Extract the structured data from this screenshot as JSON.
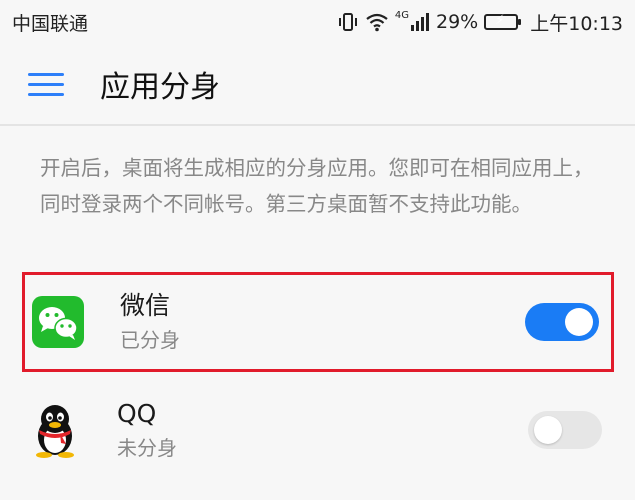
{
  "status_bar": {
    "carrier": "中国联通",
    "network": "4G",
    "battery": "29%",
    "time": "上午10:13",
    "icons": [
      "vibrate-icon",
      "wifi-icon",
      "signal-icon",
      "battery-icon"
    ]
  },
  "app_bar": {
    "title": "应用分身",
    "menu_icon": "hamburger-menu-icon"
  },
  "description": "开启后，桌面将生成相应的分身应用。您即可在相同应用上，同时登录两个不同帐号。第三方桌面暂不支持此功能。",
  "apps": [
    {
      "name": "微信",
      "status": "已分身",
      "enabled": true,
      "icon": "wechat-icon"
    },
    {
      "name": "QQ",
      "status": "未分身",
      "enabled": false,
      "icon": "qq-icon"
    }
  ],
  "colors": {
    "accent": "#1a7cf5",
    "highlight_border": "#e11b2b",
    "wechat_green": "#22bb2d",
    "battery_fill": "#2fb24a"
  }
}
